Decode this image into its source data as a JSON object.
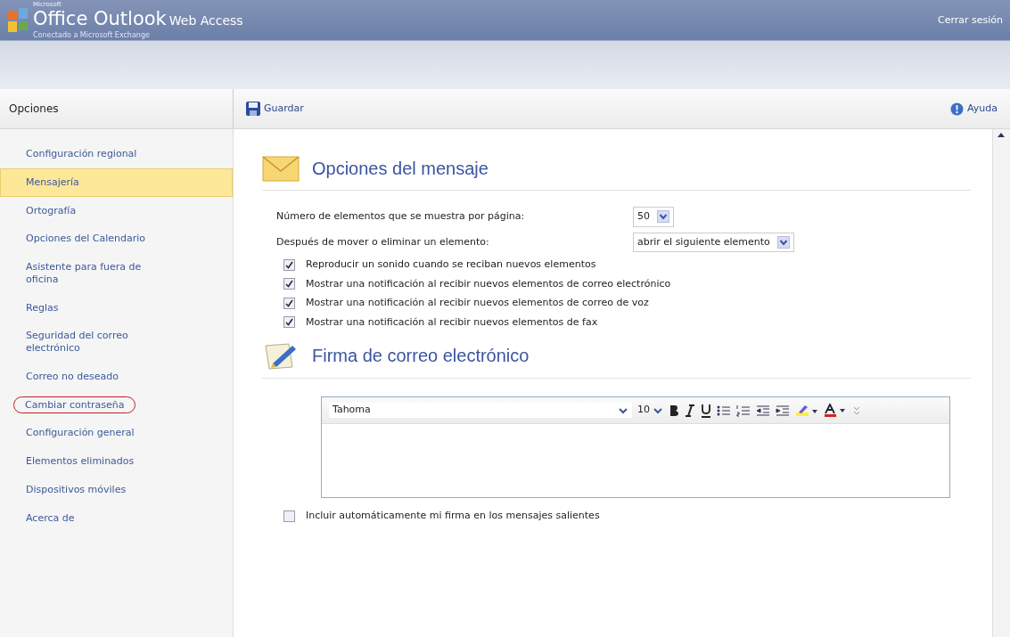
{
  "header": {
    "brand_small": "Microsoft",
    "brand_main": "Office Outlook",
    "brand_suffix": "Web Access",
    "subtitle": "Conectado a Microsoft Exchange",
    "logout": "Cerrar sesión"
  },
  "sidebar": {
    "title": "Opciones",
    "items": [
      {
        "label": "Configuración regional",
        "selected": false,
        "circled": false
      },
      {
        "label": "Mensajería",
        "selected": true,
        "circled": false
      },
      {
        "label": "Ortografía",
        "selected": false,
        "circled": false
      },
      {
        "label": "Opciones del Calendario",
        "selected": false,
        "circled": false
      },
      {
        "label": "Asistente para fuera de oficina",
        "selected": false,
        "circled": false
      },
      {
        "label": "Reglas",
        "selected": false,
        "circled": false
      },
      {
        "label": "Seguridad del correo electrónico",
        "selected": false,
        "circled": false
      },
      {
        "label": "Correo no deseado",
        "selected": false,
        "circled": false
      },
      {
        "label": "Cambiar contraseña",
        "selected": false,
        "circled": true
      },
      {
        "label": "Configuración general",
        "selected": false,
        "circled": false
      },
      {
        "label": "Elementos eliminados",
        "selected": false,
        "circled": false
      },
      {
        "label": "Dispositivos móviles",
        "selected": false,
        "circled": false
      },
      {
        "label": "Acerca de",
        "selected": false,
        "circled": false
      }
    ]
  },
  "toolbar": {
    "save": "Guardar",
    "help": "Ayuda"
  },
  "message_options": {
    "title": "Opciones del mensaje",
    "selects": [
      {
        "label": "Número de elementos que se muestra por página:",
        "value": "50"
      },
      {
        "label": "Después de mover o eliminar un elemento:",
        "value": "abrir el siguiente elemento"
      }
    ],
    "checkboxes": [
      {
        "label": "Reproducir un sonido cuando se reciban nuevos elementos",
        "checked": true
      },
      {
        "label": "Mostrar una notificación al recibir nuevos elementos de correo electrónico",
        "checked": true
      },
      {
        "label": "Mostrar una notificación al recibir nuevos elementos de correo de voz",
        "checked": true
      },
      {
        "label": "Mostrar una notificación al recibir nuevos elementos de fax",
        "checked": true
      }
    ]
  },
  "signature": {
    "title": "Firma de correo electrónico",
    "font": "Tahoma",
    "size": "10",
    "auto_include": {
      "label": "Incluir automáticamente mi firma en los mensajes salientes",
      "checked": false
    }
  }
}
